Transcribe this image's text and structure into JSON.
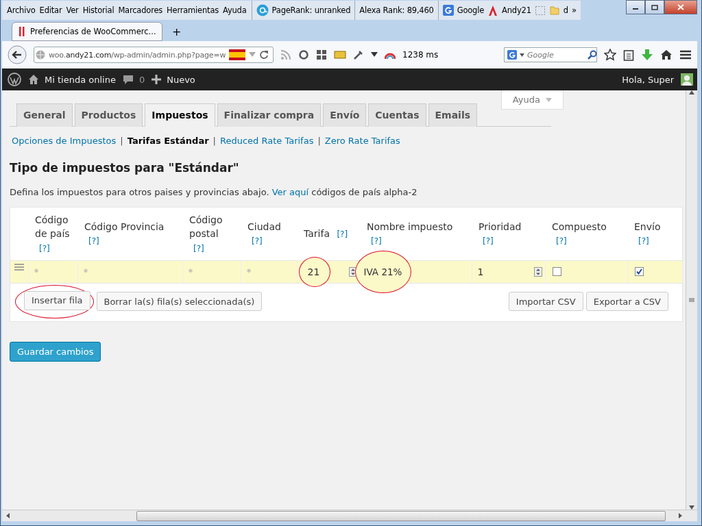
{
  "browser": {
    "menu": [
      "Archivo",
      "Editar",
      "Ver",
      "Historial",
      "Marcadores",
      "Herramientas",
      "Ayuda"
    ],
    "pagerank": "PageRank: unranked",
    "alexa": "Alexa Rank: 89,460",
    "bookmarks": [
      {
        "label": "Google",
        "kind": "google"
      },
      {
        "label": "Andy21",
        "kind": "adobe"
      },
      {
        "kind": "dashed"
      },
      {
        "label": "d",
        "kind": "folder"
      }
    ],
    "overflow": "»",
    "tabs": [
      {
        "title": "Preferencias de WooCommerc...",
        "selected": true
      }
    ],
    "new_tab": "+",
    "url": "woo.**andy21.com**/wp-admin/admin.php?page=w",
    "load_time": "1238 ms",
    "search": {
      "placeholder": "Google"
    }
  },
  "admin_bar": {
    "site": "Mi tienda online",
    "comments": "0",
    "new": "Nuevo",
    "greeting": "Hola, Super"
  },
  "help_button": "Ayuda",
  "tabs": [
    {
      "label": "General",
      "selected": false
    },
    {
      "label": "Productos",
      "selected": false
    },
    {
      "label": "Impuestos",
      "selected": true
    },
    {
      "label": "Finalizar compra",
      "selected": false
    },
    {
      "label": "Envío",
      "selected": false
    },
    {
      "label": "Cuentas",
      "selected": false
    },
    {
      "label": "Emails",
      "selected": false
    }
  ],
  "subnav": [
    {
      "label": "Opciones de Impuestos",
      "selected": false
    },
    {
      "label": "Tarifas Estándar",
      "selected": true
    },
    {
      "label": "Reduced Rate Tarifas",
      "selected": false
    },
    {
      "label": "Zero Rate Tarifas",
      "selected": false
    }
  ],
  "subnav_separator": "|",
  "heading": "Tipo de impuestos para \"Estándar\"",
  "description": {
    "before": "Defina los impuestos para otros paises y provincias abajo.",
    "link": "Ver aquí",
    "after": "códigos de país alpha-2"
  },
  "table": {
    "columns": [
      {
        "label": "Código de país",
        "help": "[?]"
      },
      {
        "label": "Código Provincia",
        "help": "[?]"
      },
      {
        "label": "Código postal",
        "help": "[?]"
      },
      {
        "label": "Ciudad",
        "help": "[?]"
      },
      {
        "label": "Tarifa",
        "help": "[?]"
      },
      {
        "label": "Nombre impuesto",
        "help": "[?]"
      },
      {
        "label": "Prioridad",
        "help": "[?]"
      },
      {
        "label": "Compuesto",
        "help": "[?]"
      },
      {
        "label": "Envío",
        "help": "[?]"
      }
    ],
    "rows": [
      {
        "cells": [
          {
            "kind": "text",
            "placeholder": "*",
            "circled": false
          },
          {
            "kind": "text",
            "placeholder": "*",
            "circled": false
          },
          {
            "kind": "text",
            "placeholder": "*",
            "circled": false
          },
          {
            "kind": "text",
            "placeholder": "*",
            "circled": false
          },
          {
            "kind": "number",
            "value": "21",
            "circled": true
          },
          {
            "kind": "text",
            "value": "IVA 21%",
            "circled": true
          },
          {
            "kind": "number",
            "value": "1",
            "circled": false
          },
          {
            "kind": "checkbox",
            "checked": false
          },
          {
            "kind": "checkbox",
            "checked": true
          }
        ]
      }
    ]
  },
  "table_buttons_left": [
    {
      "label": "Insertar fila",
      "circled": true
    },
    {
      "label": "Borrar la(s) fila(s) seleccionada(s)",
      "circled": false
    }
  ],
  "table_buttons_right": [
    {
      "label": "Importar CSV"
    },
    {
      "label": "Exportar a CSV"
    }
  ],
  "save_button": "Guardar cambios"
}
